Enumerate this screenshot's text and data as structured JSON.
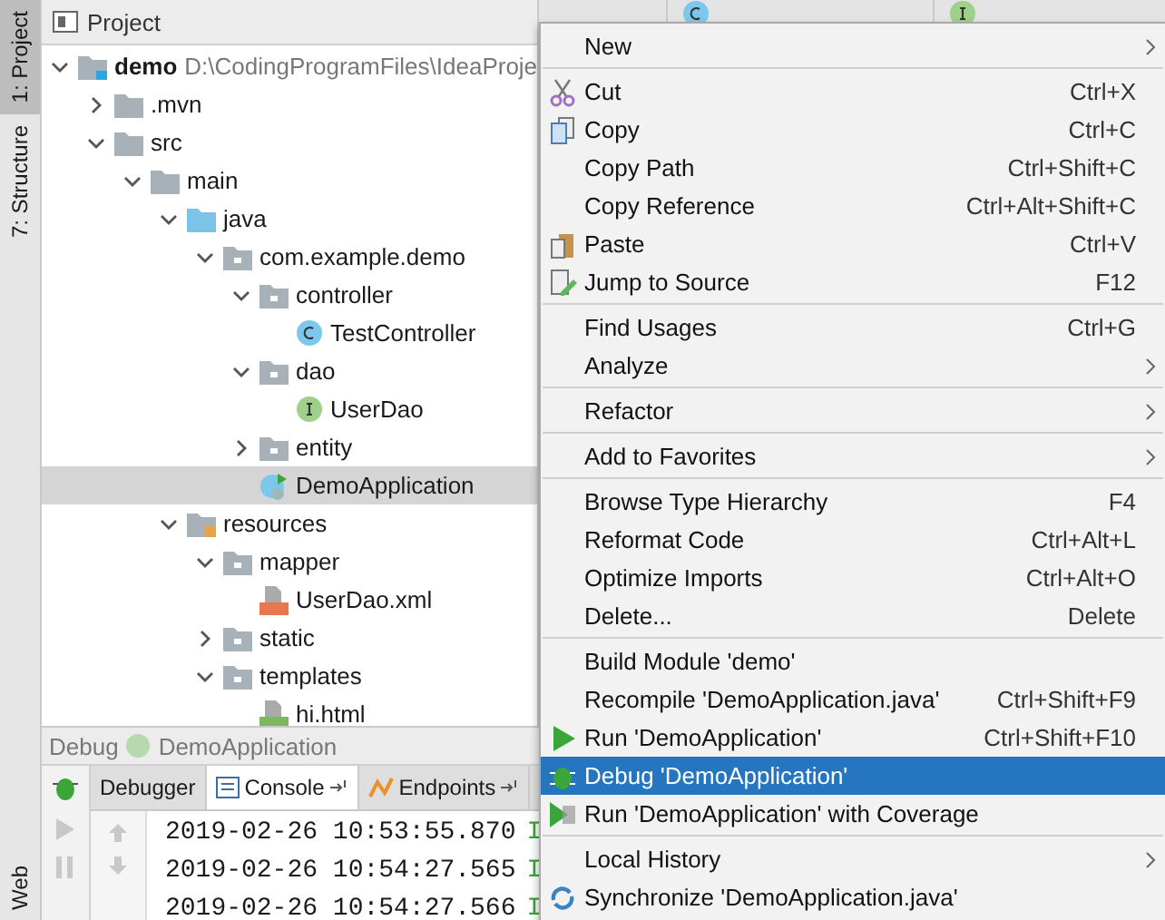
{
  "stripe": {
    "top": [
      {
        "label": "1: Project",
        "selected": true
      },
      {
        "label": "7: Structure",
        "selected": false
      }
    ],
    "bottom": [
      {
        "label": "Web",
        "selected": false
      }
    ]
  },
  "project": {
    "title": "Project",
    "tree": [
      {
        "label": "demo",
        "path": "D:\\CodingProgramFiles\\IdeaProje",
        "kind": "module",
        "expanded": true,
        "selected": false,
        "children": [
          {
            "label": ".mvn",
            "kind": "folder",
            "expanded": false,
            "selected": false
          },
          {
            "label": "src",
            "kind": "folder",
            "expanded": true,
            "selected": false,
            "children": [
              {
                "label": "main",
                "kind": "folder",
                "expanded": true,
                "selected": false,
                "children": [
                  {
                    "label": "java",
                    "kind": "source",
                    "expanded": true,
                    "selected": false,
                    "children": [
                      {
                        "label": "com.example.demo",
                        "kind": "package",
                        "expanded": true,
                        "selected": false,
                        "children": [
                          {
                            "label": "controller",
                            "kind": "package",
                            "expanded": true,
                            "selected": false,
                            "children": [
                              {
                                "label": "TestController",
                                "kind": "class",
                                "selected": false
                              }
                            ]
                          },
                          {
                            "label": "dao",
                            "kind": "package",
                            "expanded": true,
                            "selected": false,
                            "children": [
                              {
                                "label": "UserDao",
                                "kind": "interface",
                                "selected": false
                              }
                            ]
                          },
                          {
                            "label": "entity",
                            "kind": "package",
                            "expanded": false,
                            "selected": false
                          },
                          {
                            "label": "DemoApplication",
                            "kind": "app",
                            "selected": true
                          }
                        ]
                      }
                    ]
                  },
                  {
                    "label": "resources",
                    "kind": "resources",
                    "expanded": true,
                    "selected": false,
                    "children": [
                      {
                        "label": "mapper",
                        "kind": "package",
                        "expanded": true,
                        "selected": false,
                        "children": [
                          {
                            "label": "UserDao.xml",
                            "kind": "xml",
                            "selected": false
                          }
                        ]
                      },
                      {
                        "label": "static",
                        "kind": "package",
                        "expanded": false,
                        "selected": false
                      },
                      {
                        "label": "templates",
                        "kind": "package",
                        "expanded": true,
                        "selected": false,
                        "children": [
                          {
                            "label": "hi.html",
                            "kind": "html",
                            "selected": false
                          }
                        ]
                      }
                    ]
                  }
                ]
              }
            ]
          }
        ]
      }
    ]
  },
  "editor_tabs": [
    {
      "kind": "class"
    },
    {
      "kind": "interface"
    }
  ],
  "debug": {
    "title": "Debug",
    "config": "DemoApplication",
    "tabs": [
      {
        "label": "Debugger",
        "selected": false,
        "pinned": false
      },
      {
        "label": "Console",
        "selected": true,
        "pinned": true
      },
      {
        "label": "Endpoints",
        "selected": false,
        "pinned": true
      }
    ],
    "console": [
      {
        "time": "2019-02-26 10:53:55.870",
        "level": "I"
      },
      {
        "time": "2019-02-26 10:54:27.565",
        "level": "I"
      },
      {
        "time": "2019-02-26 10:54:27.566",
        "level": "I"
      }
    ]
  },
  "menu": {
    "groups": [
      [
        {
          "label": "New",
          "submenu": true,
          "kind": "plain",
          "selected": false
        }
      ],
      [
        {
          "label": "Cut",
          "shortcut": "Ctrl+X",
          "submenu": false,
          "kind": "cut",
          "selected": false
        },
        {
          "label": "Copy",
          "shortcut": "Ctrl+C",
          "submenu": false,
          "kind": "copy",
          "selected": false
        },
        {
          "label": "Copy Path",
          "shortcut": "Ctrl+Shift+C",
          "submenu": false,
          "kind": "plain",
          "selected": false
        },
        {
          "label": "Copy Reference",
          "shortcut": "Ctrl+Alt+Shift+C",
          "submenu": false,
          "kind": "plain",
          "selected": false
        },
        {
          "label": "Paste",
          "shortcut": "Ctrl+V",
          "submenu": false,
          "kind": "paste",
          "selected": false
        },
        {
          "label": "Jump to Source",
          "shortcut": "F12",
          "submenu": false,
          "kind": "jump",
          "selected": false
        }
      ],
      [
        {
          "label": "Find Usages",
          "shortcut": "Ctrl+G",
          "submenu": false,
          "kind": "plain",
          "selected": false
        },
        {
          "label": "Analyze",
          "submenu": true,
          "kind": "plain",
          "selected": false
        }
      ],
      [
        {
          "label": "Refactor",
          "submenu": true,
          "kind": "plain",
          "selected": false
        }
      ],
      [
        {
          "label": "Add to Favorites",
          "submenu": true,
          "kind": "plain",
          "selected": false
        }
      ],
      [
        {
          "label": "Browse Type Hierarchy",
          "shortcut": "F4",
          "submenu": false,
          "kind": "plain",
          "selected": false
        },
        {
          "label": "Reformat Code",
          "shortcut": "Ctrl+Alt+L",
          "submenu": false,
          "kind": "plain",
          "selected": false
        },
        {
          "label": "Optimize Imports",
          "shortcut": "Ctrl+Alt+O",
          "submenu": false,
          "kind": "plain",
          "selected": false
        },
        {
          "label": "Delete...",
          "shortcut": "Delete",
          "submenu": false,
          "kind": "plain",
          "selected": false
        }
      ],
      [
        {
          "label": "Build Module 'demo'",
          "submenu": false,
          "kind": "plain",
          "selected": false
        },
        {
          "label": "Recompile 'DemoApplication.java'",
          "shortcut": "Ctrl+Shift+F9",
          "submenu": false,
          "kind": "plain",
          "selected": false
        },
        {
          "label": "Run 'DemoApplication'",
          "shortcut": "Ctrl+Shift+F10",
          "submenu": false,
          "kind": "run",
          "selected": false
        },
        {
          "label": "Debug 'DemoApplication'",
          "submenu": false,
          "kind": "debug",
          "selected": true
        },
        {
          "label": "Run 'DemoApplication' with Coverage",
          "submenu": false,
          "kind": "coverage",
          "selected": false
        }
      ],
      [
        {
          "label": "Local History",
          "submenu": true,
          "kind": "plain",
          "selected": false
        },
        {
          "label": "Synchronize 'DemoApplication.java'",
          "submenu": false,
          "kind": "sync",
          "selected": false
        }
      ]
    ]
  }
}
